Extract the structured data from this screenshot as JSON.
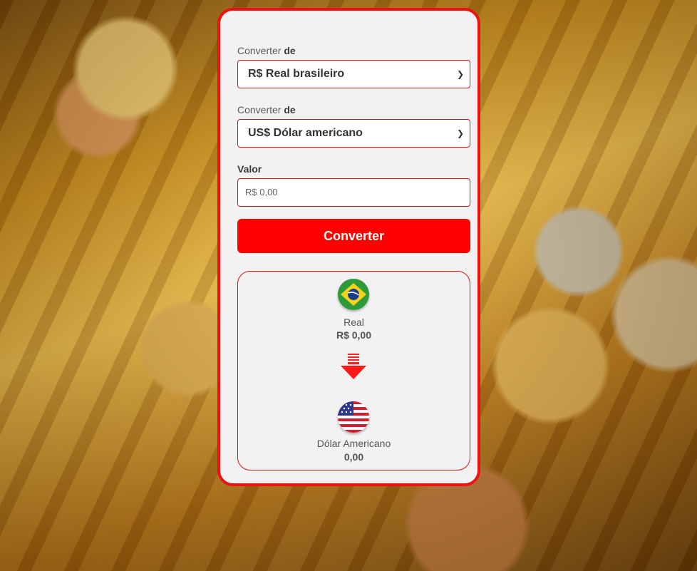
{
  "form": {
    "from_label_text": "Converter",
    "from_label_bold": "de",
    "from_select_value": "R$ Real brasileiro",
    "to_label_text": "Converter",
    "to_label_bold": "de",
    "to_select_value": "US$ Dólar americano",
    "amount_label": "Valor",
    "amount_placeholder": "R$ 0,00",
    "convert_button": "Converter"
  },
  "result": {
    "source_name": "Real",
    "source_value": "R$ 0,00",
    "target_name": "Dólar Americano",
    "target_value": "0,00"
  },
  "colors": {
    "accent": "#ff0000",
    "card_bg": "#f2f2f2"
  },
  "icons": {
    "source_flag": "brazil-flag-icon",
    "arrow": "arrow-down-icon",
    "target_flag": "usa-flag-icon",
    "dropdown": "chevron-down-icon"
  }
}
